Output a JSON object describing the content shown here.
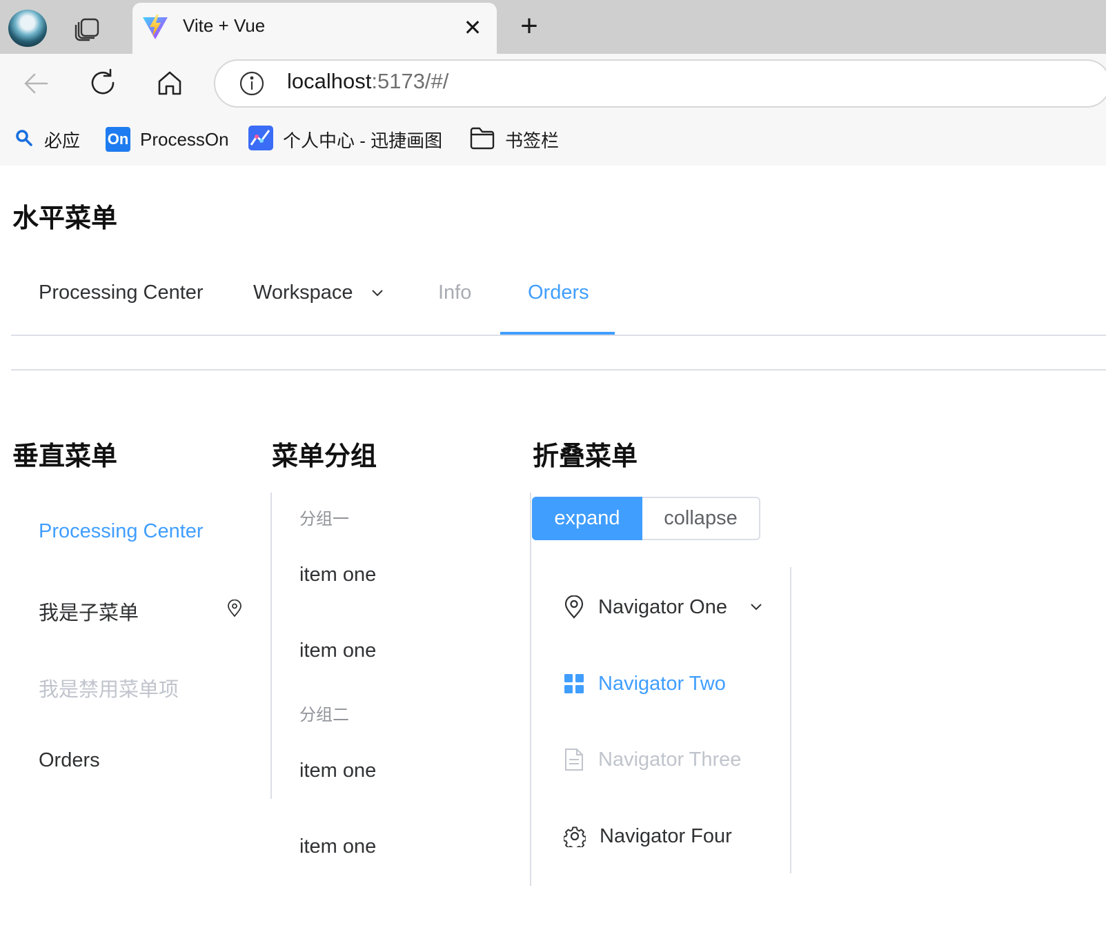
{
  "browser": {
    "tab_title": "Vite + Vue",
    "tab_close": "✕",
    "new_tab": "+",
    "url_host": "localhost",
    "url_rest": ":5173/#/",
    "bookmarks": [
      "必应",
      "ProcessOn",
      "个人中心 - 迅捷画图",
      "书签栏"
    ],
    "processon_badge": "On"
  },
  "page": {
    "horizontal_heading": "水平菜单",
    "horizontal_menu": {
      "items": [
        "Processing Center",
        "Workspace",
        "Info",
        "Orders"
      ],
      "active": "Orders",
      "disabled": "Info"
    },
    "vertical_heading": "垂直菜单",
    "vertical_menu": {
      "items": [
        "Processing Center",
        "我是子菜单",
        "我是禁用菜单项",
        "Orders"
      ],
      "active": "Processing Center",
      "disabled": "我是禁用菜单项"
    },
    "group_heading": "菜单分组",
    "group_menu": {
      "groups": [
        {
          "title": "分组一",
          "items": [
            "item one",
            "item one"
          ]
        },
        {
          "title": "分组二",
          "items": [
            "item one",
            "item one"
          ]
        }
      ]
    },
    "collapse_heading": "折叠菜单",
    "collapse_toggle": {
      "expand": "expand",
      "collapse": "collapse",
      "selected": "expand"
    },
    "collapse_menu": {
      "items": [
        {
          "label": "Navigator One",
          "icon": "location-icon"
        },
        {
          "label": "Navigator Two",
          "icon": "grid-icon"
        },
        {
          "label": "Navigator Three",
          "icon": "document-icon"
        },
        {
          "label": "Navigator Four",
          "icon": "settings-icon"
        }
      ],
      "active": "Navigator Two",
      "disabled": "Navigator Three"
    }
  },
  "colors": {
    "primary": "#409eff",
    "disabled": "#c0c4cc",
    "text": "#303133",
    "border": "#dcdfe6"
  }
}
